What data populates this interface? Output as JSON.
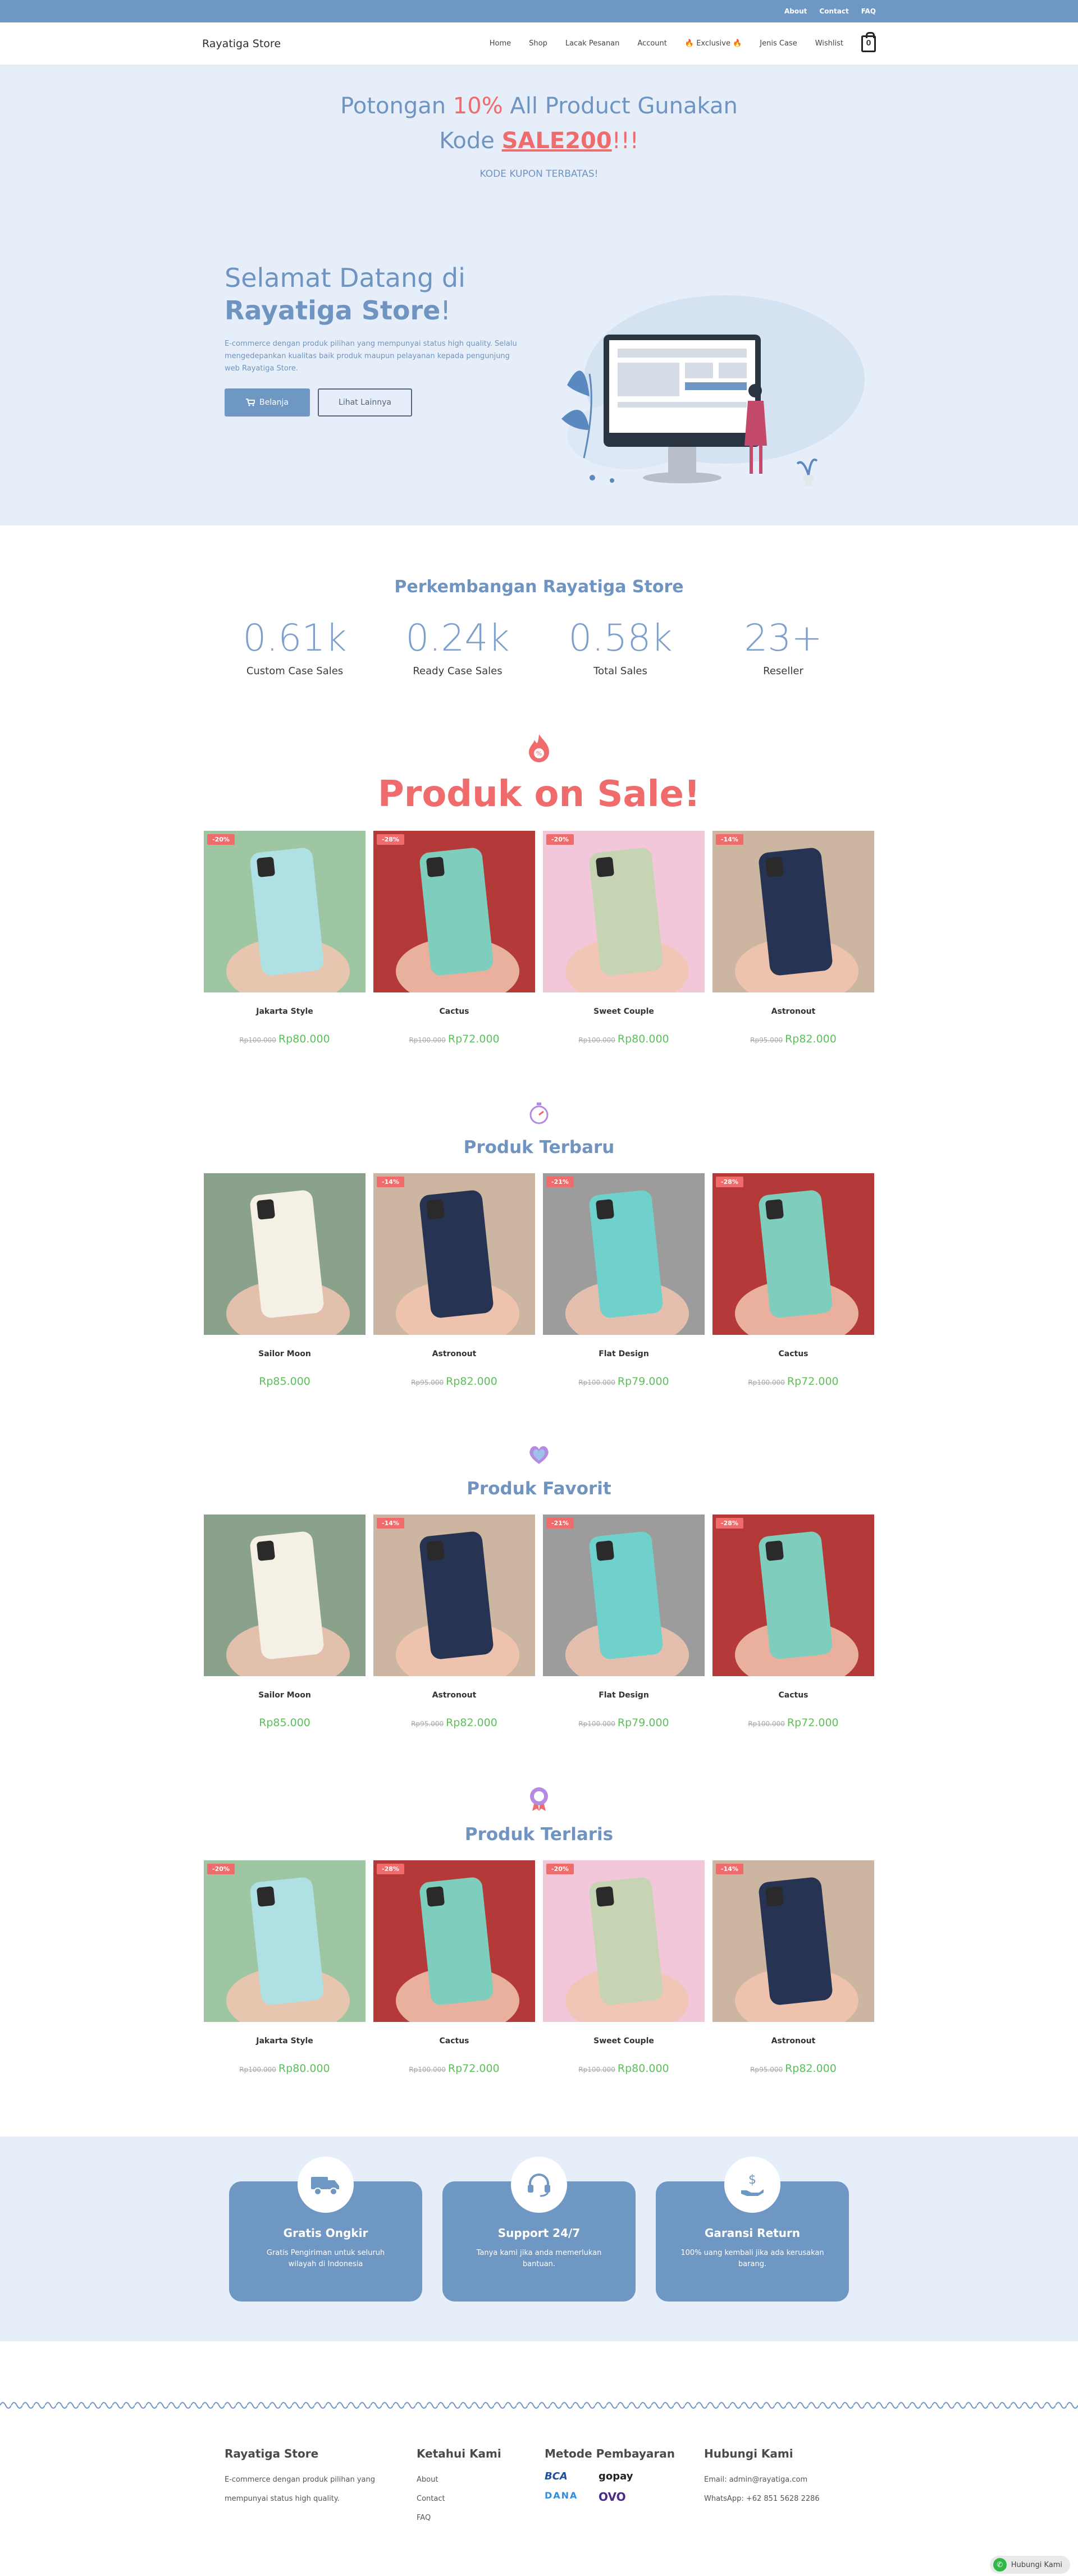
{
  "topbar": {
    "links": [
      "About",
      "Contact",
      "FAQ"
    ]
  },
  "nav": {
    "brand": "Rayatiga Store",
    "items": [
      "Home",
      "Shop",
      "Lacak Pesanan",
      "Account",
      "🔥 Exclusive 🔥",
      "Jenis Case",
      "Wishlist"
    ],
    "cart_count": "0"
  },
  "promo": {
    "line1_a": "Potongan ",
    "line1_b": "10%",
    "line1_c": " All Product Gunakan",
    "line2_a": "Kode ",
    "line2_b": "SALE200",
    "line2_c": "!!!",
    "sub": "KODE KUPON TERBATAS!"
  },
  "welcome": {
    "title_a": "Selamat Datang di",
    "title_b": "Rayatiga Store",
    "title_c": "!",
    "desc": "E-commerce dengan produk pilihan yang mempunyai status high quality. Selalu mengedepankan kualitas baik produk maupun pelayanan kepada pengunjung web Rayatiga Store.",
    "btn_primary": "Belanja",
    "btn_secondary": "Lihat Lainnya"
  },
  "stats": {
    "title": "Perkembangan Rayatiga Store",
    "items": [
      {
        "value": "0.61k",
        "label": "Custom Case Sales"
      },
      {
        "value": "0.24k",
        "label": "Ready Case Sales"
      },
      {
        "value": "0.58k",
        "label": "Total Sales"
      },
      {
        "value": "23+",
        "label": "Reseller"
      }
    ]
  },
  "blocks": {
    "sale": {
      "title": "Produk on Sale!",
      "products": [
        {
          "name": "Jakarta Style",
          "old": "Rp100.000",
          "price": "Rp80.000",
          "disc": "-20%",
          "bg": "#9fc6a2",
          "case": "#aee0e4"
        },
        {
          "name": "Cactus",
          "old": "Rp100.000",
          "price": "Rp72.000",
          "disc": "-28%",
          "bg": "#b43a3a",
          "case": "#7fcdbd"
        },
        {
          "name": "Sweet Couple",
          "old": "Rp100.000",
          "price": "Rp80.000",
          "disc": "-20%",
          "bg": "#f1c7d9",
          "case": "#c7d4b4"
        },
        {
          "name": "Astronout",
          "old": "Rp95.000",
          "price": "Rp82.000",
          "disc": "-14%",
          "bg": "#cdb6a1",
          "case": "#263352"
        }
      ]
    },
    "new": {
      "title": "Produk Terbaru",
      "products": [
        {
          "name": "Sailor Moon",
          "old": "",
          "price": "Rp85.000",
          "disc": "",
          "bg": "#8aa28c",
          "case": "#f4f0e6"
        },
        {
          "name": "Astronout",
          "old": "Rp95.000",
          "price": "Rp82.000",
          "disc": "-14%",
          "bg": "#cdb6a1",
          "case": "#263352"
        },
        {
          "name": "Flat Design",
          "old": "Rp100.000",
          "price": "Rp79.000",
          "disc": "-21%",
          "bg": "#9c9c9c",
          "case": "#6fd0cc"
        },
        {
          "name": "Cactus",
          "old": "Rp100.000",
          "price": "Rp72.000",
          "disc": "-28%",
          "bg": "#b43a3a",
          "case": "#7fcdbd"
        }
      ]
    },
    "fav": {
      "title": "Produk Favorit",
      "products": [
        {
          "name": "Sailor Moon",
          "old": "",
          "price": "Rp85.000",
          "disc": "",
          "bg": "#8aa28c",
          "case": "#f4f0e6"
        },
        {
          "name": "Astronout",
          "old": "Rp95.000",
          "price": "Rp82.000",
          "disc": "-14%",
          "bg": "#cdb6a1",
          "case": "#263352"
        },
        {
          "name": "Flat Design",
          "old": "Rp100.000",
          "price": "Rp79.000",
          "disc": "-21%",
          "bg": "#9c9c9c",
          "case": "#6fd0cc"
        },
        {
          "name": "Cactus",
          "old": "Rp100.000",
          "price": "Rp72.000",
          "disc": "-28%",
          "bg": "#b43a3a",
          "case": "#7fcdbd"
        }
      ]
    },
    "best": {
      "title": "Produk Terlaris",
      "products": [
        {
          "name": "Jakarta Style",
          "old": "Rp100.000",
          "price": "Rp80.000",
          "disc": "-20%",
          "bg": "#9fc6a2",
          "case": "#aee0e4"
        },
        {
          "name": "Cactus",
          "old": "Rp100.000",
          "price": "Rp72.000",
          "disc": "-28%",
          "bg": "#b43a3a",
          "case": "#7fcdbd"
        },
        {
          "name": "Sweet Couple",
          "old": "Rp100.000",
          "price": "Rp80.000",
          "disc": "-20%",
          "bg": "#f1c7d9",
          "case": "#c7d4b4"
        },
        {
          "name": "Astronout",
          "old": "Rp95.000",
          "price": "Rp82.000",
          "disc": "-14%",
          "bg": "#cdb6a1",
          "case": "#263352"
        }
      ]
    }
  },
  "features": [
    {
      "title": "Gratis Ongkir",
      "desc": "Gratis Pengiriman untuk seluruh wilayah di Indonesia",
      "icon": "truck-icon"
    },
    {
      "title": "Support 24/7",
      "desc": "Tanya kami jika anda memerlukan bantuan.",
      "icon": "headset-icon"
    },
    {
      "title": "Garansi Return",
      "desc": "100% uang kembali jika ada kerusakan barang.",
      "icon": "money-hand-icon"
    }
  ],
  "footer": {
    "brand": "Rayatiga Store",
    "brand_desc": "E-commerce dengan produk pilihan yang mempunyai status high quality.",
    "col2_title": "Ketahui Kami",
    "col2_links": [
      "About",
      "Contact",
      "FAQ"
    ],
    "col3_title": "Metode Pembayaran",
    "payments": [
      "BCA",
      "gopay",
      "DANA",
      "OVO"
    ],
    "col4_title": "Hubungi Kami",
    "email": "Email: admin@rayatiga.com",
    "whatsapp": "WhatsApp: +62 851 5628 2286"
  },
  "chat_button": "Hubungi Kami",
  "colors": {
    "accent": "#6f97c4",
    "sale": "#f06b6b",
    "price": "#5bbf5b",
    "hero_bg": "#e6eff9"
  }
}
